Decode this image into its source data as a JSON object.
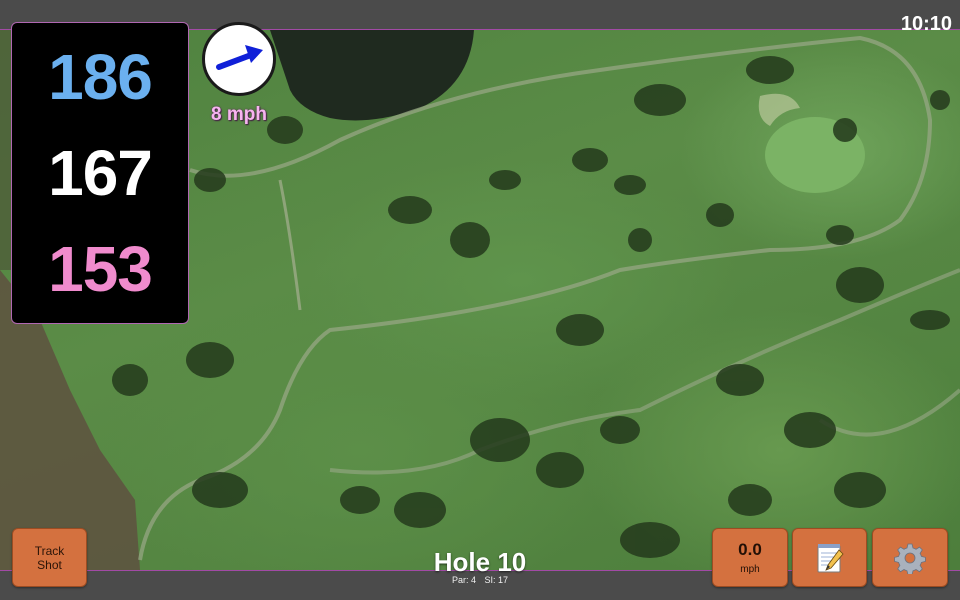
{
  "clock": {
    "time": "10:10"
  },
  "distances": {
    "back": "186",
    "middle": "167",
    "front": "153"
  },
  "wind": {
    "speed": "8 mph",
    "direction_label": "east-northeast"
  },
  "buttons": {
    "track_shot_line1": "Track",
    "track_shot_line2": "Shot",
    "speed_value": "0.0",
    "speed_unit": "mph",
    "notes_icon": "notepad-icon",
    "settings_icon": "gear-icon"
  },
  "hole": {
    "title": "Hole 10",
    "par": "Par: 4",
    "si": "SI: 17"
  },
  "colors": {
    "accent_border": "#a24aa6",
    "back_distance": "#6bb0ef",
    "middle_distance": "#ffffff",
    "front_distance": "#f08bcd",
    "button_orange": "#d4713f"
  }
}
